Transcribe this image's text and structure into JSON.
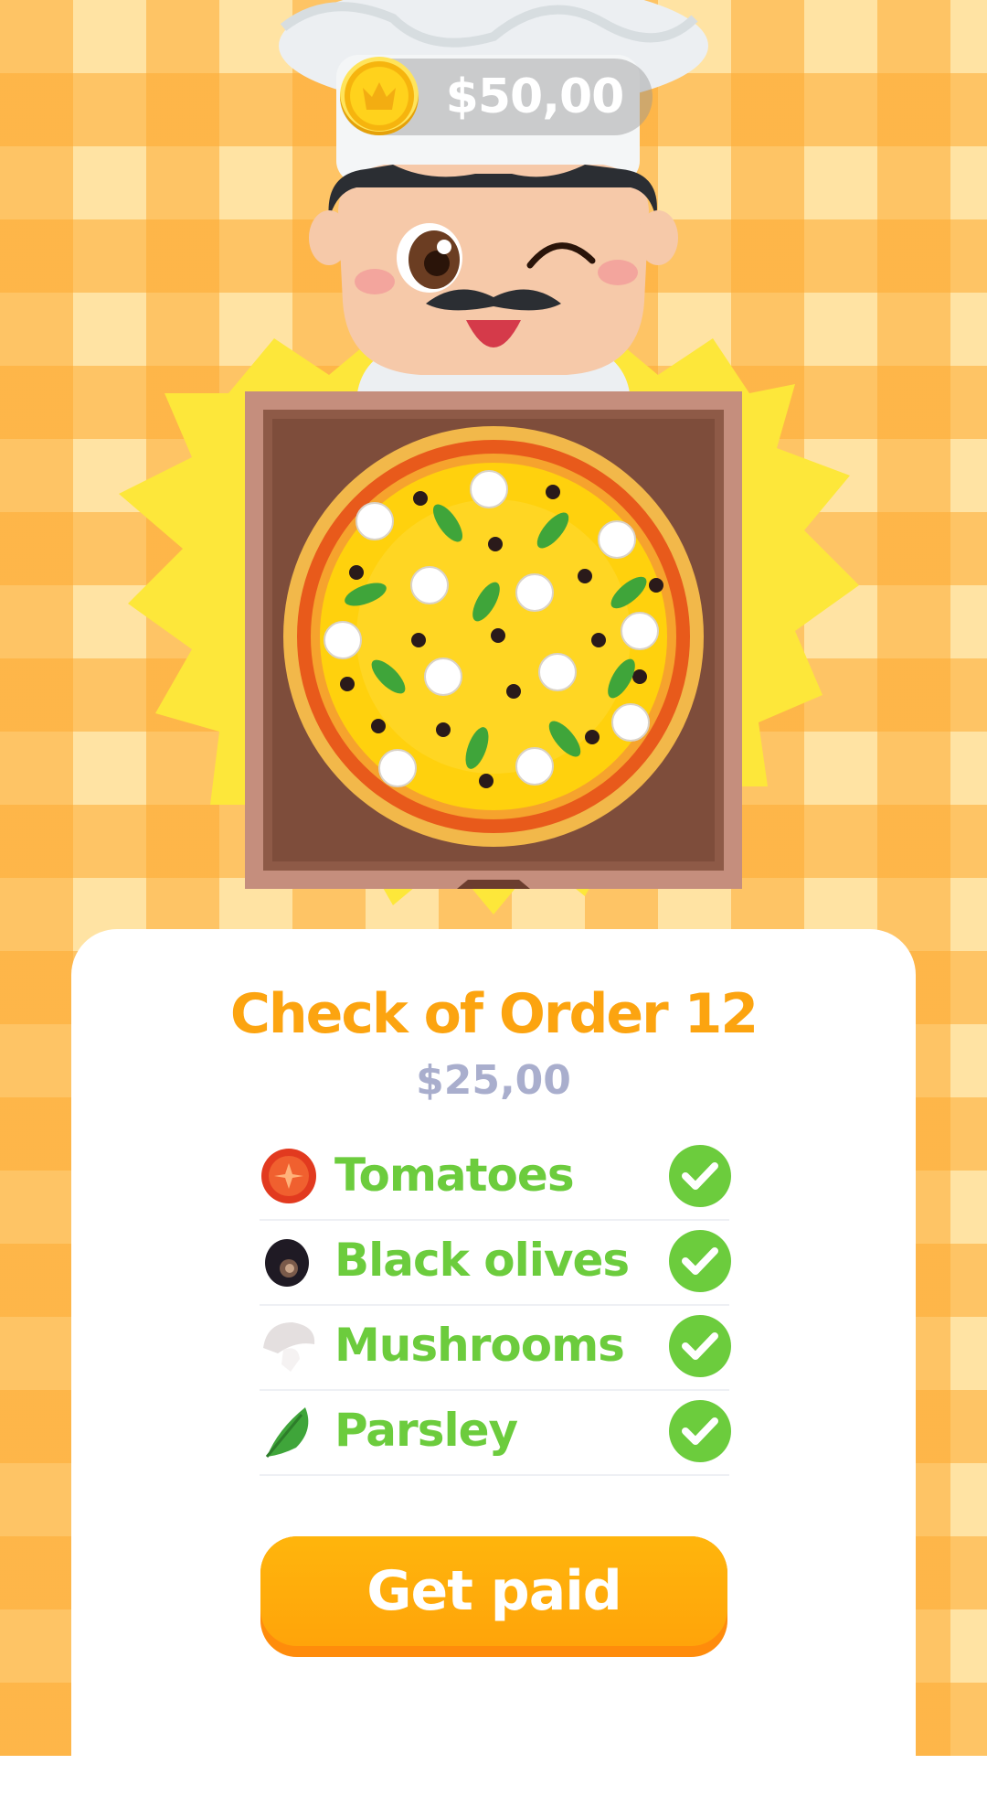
{
  "wallet": {
    "balance": "$50,00",
    "coin_icon": "coin-icon"
  },
  "order": {
    "title": "Check of Order 12",
    "price": "$25,00",
    "ingredients": [
      {
        "label": "Tomatoes",
        "icon": "tomato-icon",
        "checked": true
      },
      {
        "label": "Black olives",
        "icon": "olive-icon",
        "checked": true
      },
      {
        "label": "Mushrooms",
        "icon": "mushroom-icon",
        "checked": true
      },
      {
        "label": "Parsley",
        "icon": "parsley-icon",
        "checked": true
      }
    ]
  },
  "actions": {
    "get_paid": "Get paid"
  },
  "colors": {
    "accent": "#fca410",
    "success": "#6ccc3d",
    "price": "#a9aecd",
    "button": "#ffa40a"
  }
}
